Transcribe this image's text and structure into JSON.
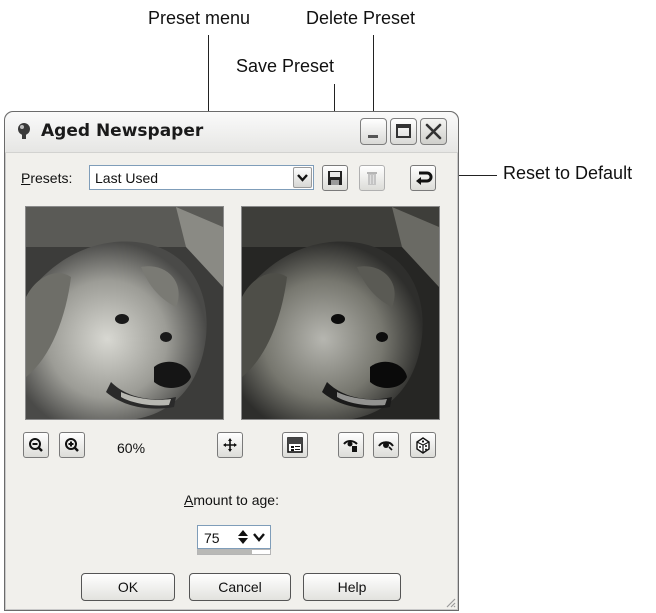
{
  "callouts": {
    "preset_menu": "Preset menu",
    "delete_preset": "Delete Preset",
    "save_preset": "Save Preset",
    "reset_to_default": "Reset to Default"
  },
  "dialog": {
    "title": "Aged Newspaper",
    "presets_label_first": "P",
    "presets_label_rest": "resets:",
    "presets_value": "Last Used",
    "zoom_level": "60%",
    "amount_label_first": "A",
    "amount_label_rest": "mount to age:",
    "amount_value": "75",
    "amount_fraction": 0.75,
    "buttons": {
      "ok": "OK",
      "cancel": "Cancel",
      "help": "Help"
    }
  },
  "icons": {
    "app": "app-icon",
    "minimize": "minimize-icon",
    "maximize": "maximize-icon",
    "close": "close-icon",
    "dropdown": "chevron-down-icon",
    "save": "save-icon",
    "delete": "trash-icon",
    "reset": "reset-icon",
    "zoom_out": "zoom-out-icon",
    "zoom_in": "zoom-in-icon",
    "pan": "move-icon",
    "split": "split-preview-icon",
    "proof": "proof-icon",
    "autoproof": "auto-proof-icon",
    "randomize": "randomize-icon"
  },
  "colors": {
    "close_button": "#d8d8d4",
    "dialog_face": "#f1f0ec"
  }
}
